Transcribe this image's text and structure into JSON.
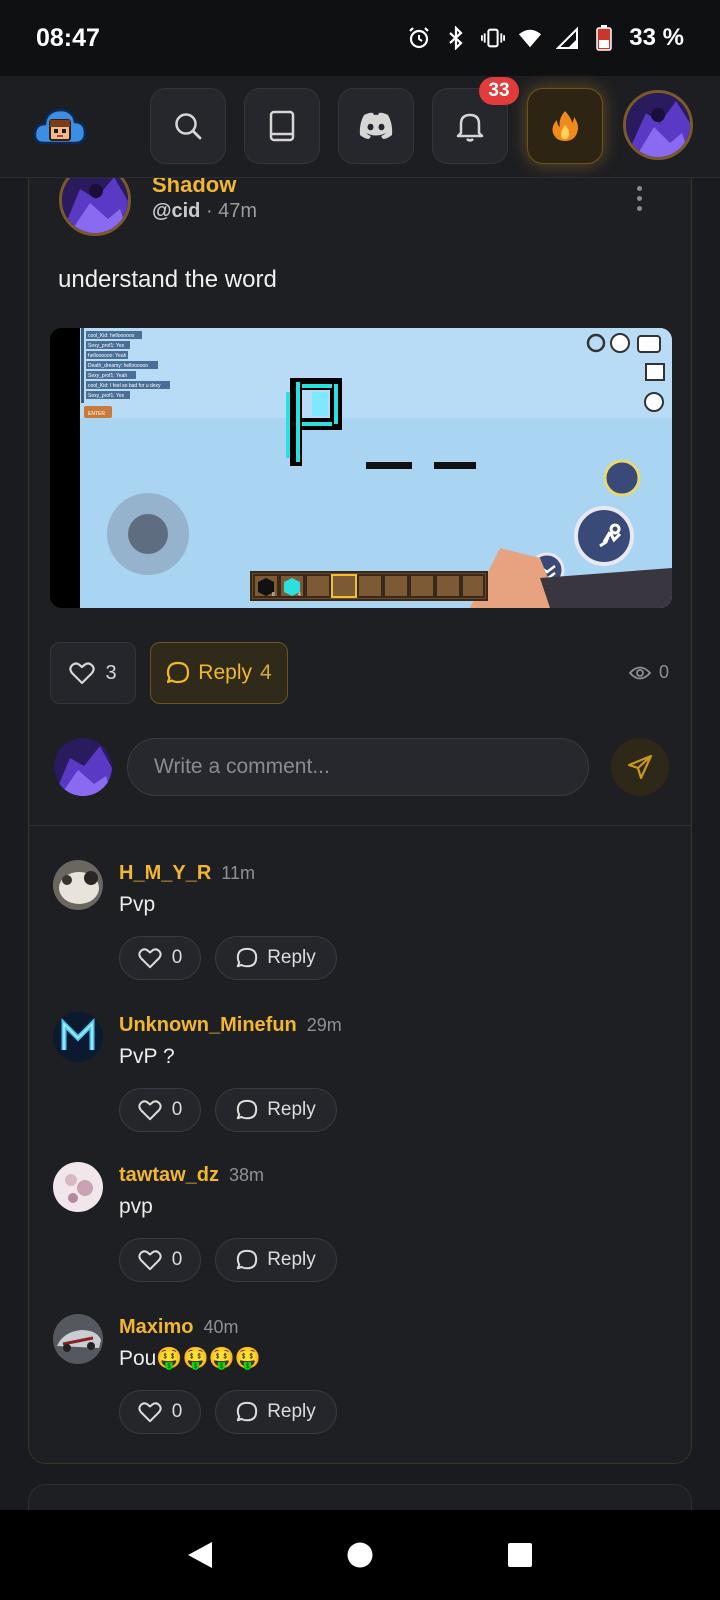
{
  "status_bar": {
    "time": "08:47",
    "battery": "33 %",
    "icons": [
      "alarm-icon",
      "bluetooth-icon",
      "vibrate-icon",
      "wifi-icon",
      "signal-icon",
      "battery-icon"
    ]
  },
  "app_bar": {
    "buttons": [
      "search-icon",
      "book-icon",
      "discord-icon",
      "bell-icon",
      "fire-icon"
    ],
    "notification_count": "33",
    "accent_color": "#f2b72d"
  },
  "post": {
    "author_name": "Shadow",
    "author_handle": "@cid",
    "time": "· 47m",
    "text": "understand the word",
    "likes": "3",
    "reply_label": "Reply",
    "reply_count": "4",
    "views": "0",
    "media": {
      "chat_lines": [
        "cool_Kid: helloooooo",
        "Sexy_prof1: Yes",
        "helloooooo: Yeah",
        "Death_dreamy: helloooooo",
        "Sexy_prof1: Yeah",
        "cool_Kid: I feel so bad for u dexy",
        "Sexy_prof1: Yes"
      ],
      "enter_label": "ENTER",
      "hotbar_counts": [
        "8",
        "4"
      ]
    }
  },
  "comment_box": {
    "placeholder": "Write a comment..."
  },
  "replies": [
    {
      "name": "H_M_Y_R",
      "time": "11m",
      "text": "Pvp",
      "likes": "0",
      "reply_label": "Reply"
    },
    {
      "name": "Unknown_Minefun",
      "time": "29m",
      "text": "PvP ?",
      "likes": "0",
      "reply_label": "Reply"
    },
    {
      "name": "tawtaw_dz",
      "time": "38m",
      "text": "pvp",
      "likes": "0",
      "reply_label": "Reply"
    },
    {
      "name": "Maximo",
      "time": "40m",
      "text": "Pou🤑🤑🤑🤑",
      "likes": "0",
      "reply_label": "Reply"
    }
  ]
}
